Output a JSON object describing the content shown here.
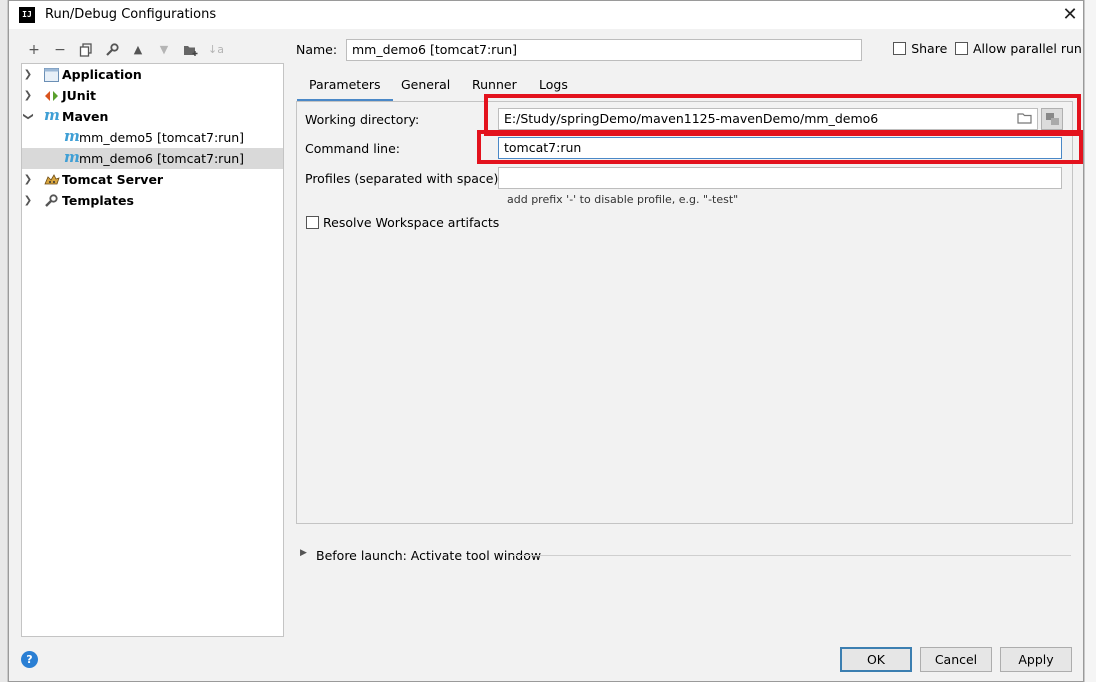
{
  "window": {
    "title": "Run/Debug Configurations",
    "app_icon_text": "IJ"
  },
  "toolbar": {
    "add": "+",
    "remove": "−",
    "copy": "⧉",
    "edit": "🔧",
    "up": "▲",
    "down": "▼",
    "folder": "📁",
    "sort": "↓a"
  },
  "tree": {
    "items": [
      {
        "label": "Application",
        "icon": "application-icon"
      },
      {
        "label": "JUnit",
        "icon": "junit-icon"
      },
      {
        "label": "Maven",
        "icon": "maven-icon"
      },
      {
        "label": "mm_demo5 [tomcat7:run]",
        "icon": "maven-icon"
      },
      {
        "label": "mm_demo6 [tomcat7:run]",
        "icon": "maven-icon"
      },
      {
        "label": "Tomcat Server",
        "icon": "tomcat-icon"
      },
      {
        "label": "Templates",
        "icon": "wrench-icon"
      }
    ],
    "maven_glyph": "m"
  },
  "form": {
    "name_label": "Name:",
    "name_value": "mm_demo6 [tomcat7:run]",
    "share_label": "Share",
    "allow_parallel_label": "Allow parallel run",
    "tabs": [
      "Parameters",
      "General",
      "Runner",
      "Logs"
    ],
    "working_dir_label": "Working directory:",
    "working_dir_value": "E:/Study/springDemo/maven1125-mavenDemo/mm_demo6",
    "command_line_label": "Command line:",
    "command_line_value": "tomcat7:run",
    "profiles_label": "Profiles (separated with space):",
    "profiles_value": "",
    "profiles_hint": "add prefix '-' to disable profile, e.g. \"-test\"",
    "resolve_label": "Resolve Workspace artifacts",
    "before_launch": "Before launch: Activate tool window"
  },
  "buttons": {
    "ok": "OK",
    "cancel": "Cancel",
    "apply": "Apply",
    "help": "?"
  },
  "colors": {
    "accent": "#4a88c7",
    "highlight_red": "#e3121d",
    "selection": "#d9d9d9"
  }
}
